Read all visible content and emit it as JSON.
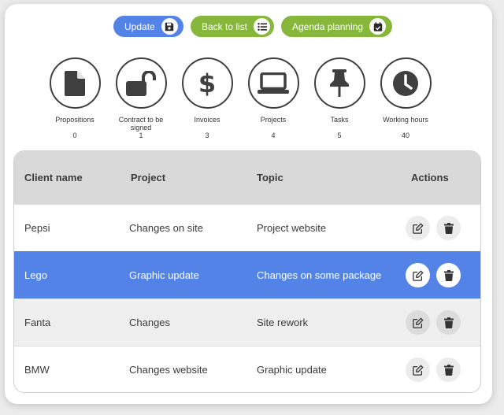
{
  "toolbar": {
    "update_label": "Update",
    "back_label": "Back to list",
    "agenda_label": "Agenda planning"
  },
  "stats": [
    {
      "label": "Propositions",
      "count": "0",
      "icon": "document-icon"
    },
    {
      "label": "Contract to be signed",
      "count": "1",
      "icon": "unlock-icon"
    },
    {
      "label": "Invoices",
      "count": "3",
      "icon": "dollar-icon"
    },
    {
      "label": "Projects",
      "count": "4",
      "icon": "laptop-icon"
    },
    {
      "label": "Tasks",
      "count": "5",
      "icon": "pushpin-icon"
    },
    {
      "label": "Working hours",
      "count": "40",
      "icon": "clock-icon"
    }
  ],
  "table": {
    "headers": {
      "client": "Client name",
      "project": "Project",
      "topic": "Topic",
      "actions": "Actions"
    },
    "rows": [
      {
        "client": "Pepsi",
        "project": "Changes on site",
        "topic": "Project website"
      },
      {
        "client": "Lego",
        "project": "Graphic update",
        "topic": "Changes on some package"
      },
      {
        "client": "Fanta",
        "project": "Changes",
        "topic": "Site rework"
      },
      {
        "client": "BMW",
        "project": "Changes website",
        "topic": "Graphic update"
      }
    ]
  },
  "colors": {
    "primary": "#5483e8",
    "accent": "#86b63a",
    "header_bg": "#d9d9d9",
    "icon_dark": "#3f3f3f"
  }
}
